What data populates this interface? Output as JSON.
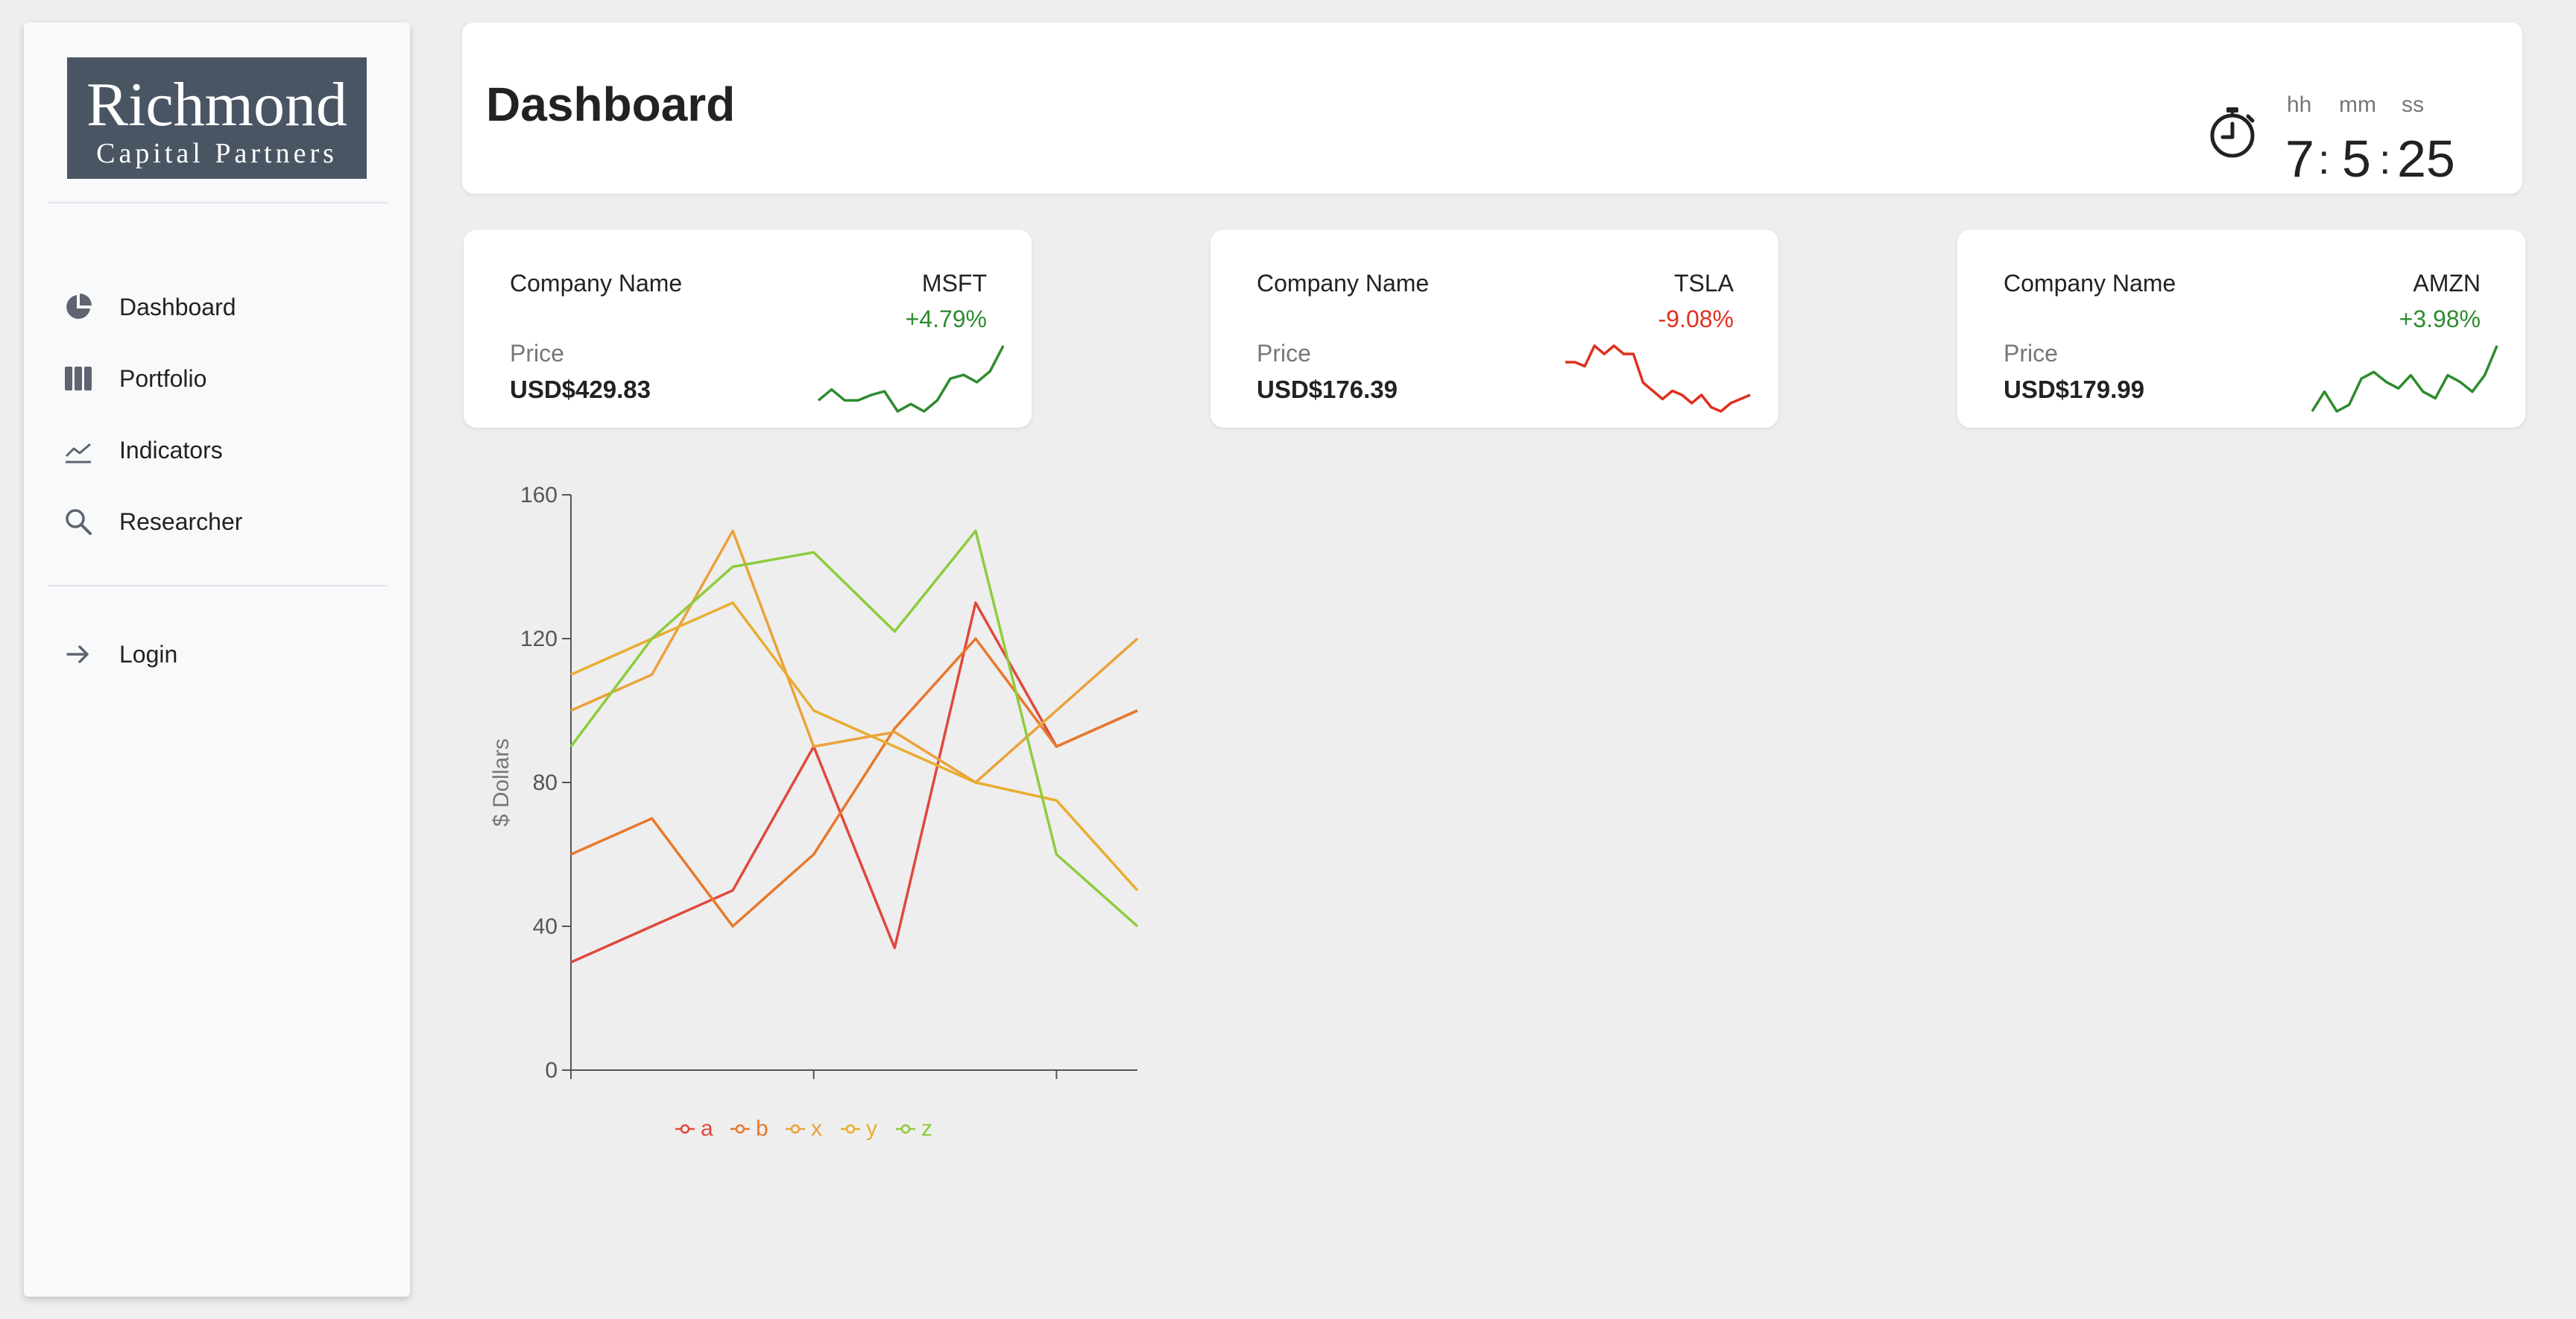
{
  "sidebar": {
    "logo": {
      "line1": "Richmond",
      "line2": "Capital Partners"
    },
    "nav": [
      {
        "label": "Dashboard",
        "icon": "pie-chart-icon"
      },
      {
        "label": "Portfolio",
        "icon": "columns-icon"
      },
      {
        "label": "Indicators",
        "icon": "trend-line-icon"
      },
      {
        "label": "Researcher",
        "icon": "search-icon"
      }
    ],
    "login": {
      "label": "Login",
      "icon": "arrow-right-icon"
    }
  },
  "header": {
    "title": "Dashboard",
    "timer": {
      "icon": "stopwatch-icon",
      "labels": {
        "hh": "hh",
        "mm": "mm",
        "ss": "ss"
      },
      "hours": "7",
      "minutes": "5",
      "seconds": "25",
      "separator": ":"
    }
  },
  "cards": [
    {
      "company_label": "Company Name",
      "ticker": "MSFT",
      "change": "+4.79%",
      "price_label": "Price",
      "price": "USD$429.83",
      "trend": "up",
      "color": "#2e8b2e",
      "spark": [
        5,
        8,
        5,
        5,
        6.5,
        7.5,
        2,
        4,
        2,
        5,
        11,
        12,
        10,
        13,
        20
      ]
    },
    {
      "company_label": "Company Name",
      "ticker": "TSLA",
      "change": "-9.08%",
      "price_label": "Price",
      "price": "USD$176.39",
      "trend": "down",
      "color": "#e0301e",
      "spark": [
        14,
        14,
        13,
        18,
        16,
        18,
        16,
        16,
        9,
        7,
        5,
        7,
        6,
        4,
        6,
        3,
        2,
        4,
        5,
        6
      ]
    },
    {
      "company_label": "Company Name",
      "ticker": "AMZN",
      "change": "+3.98%",
      "price_label": "Price",
      "price": "USD$179.99",
      "trend": "up",
      "color": "#2e8b2e",
      "spark": [
        2,
        8,
        2,
        4,
        12,
        14,
        11,
        9,
        13,
        8,
        6,
        13,
        11,
        8,
        13,
        22
      ]
    }
  ],
  "chart_data": {
    "type": "line",
    "title": "",
    "xlabel": "",
    "ylabel": "$ Dollars",
    "ylim": [
      0,
      160
    ],
    "yticks": [
      0,
      40,
      80,
      120,
      160
    ],
    "x": [
      0,
      1,
      2,
      3,
      4,
      5,
      6,
      7
    ],
    "legend_position": "bottom",
    "series": [
      {
        "name": "a",
        "color": "#e0483c",
        "values": [
          30,
          40,
          50,
          90,
          34,
          130,
          90,
          100
        ]
      },
      {
        "name": "b",
        "color": "#e8782a",
        "values": [
          60,
          70,
          40,
          60,
          95,
          120,
          90,
          100
        ]
      },
      {
        "name": "x",
        "color": "#eba13a",
        "values": [
          100,
          110,
          150,
          90,
          94,
          80,
          100,
          120
        ]
      },
      {
        "name": "y",
        "color": "#e8ad30",
        "values": [
          110,
          120,
          130,
          100,
          90,
          80,
          75,
          50
        ]
      },
      {
        "name": "z",
        "color": "#8dcc3c",
        "values": [
          90,
          120,
          140,
          144,
          122,
          150,
          60,
          40
        ]
      }
    ]
  }
}
